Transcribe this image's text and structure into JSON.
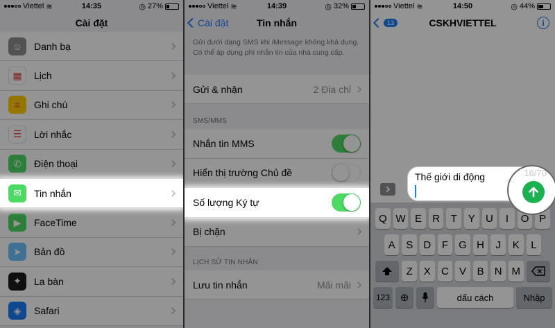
{
  "status": {
    "p1": {
      "carrier": "Viettel",
      "time": "14:35",
      "battery": "27%",
      "battery_level": 0.27
    },
    "p2": {
      "carrier": "Viettel",
      "time": "14:39",
      "battery": "32%",
      "battery_level": 0.32
    },
    "p3": {
      "carrier": "Viettel",
      "time": "14:50",
      "battery": "44%",
      "battery_level": 0.44
    }
  },
  "settings": {
    "title": "Cài đặt",
    "items": [
      {
        "label": "Danh bạ",
        "icon": "contacts-icon",
        "color": "#8e8e93"
      },
      {
        "label": "Lịch",
        "icon": "calendar-icon",
        "color": "#ffffff"
      },
      {
        "label": "Ghi chú",
        "icon": "notes-icon",
        "color": "#ffcc00"
      },
      {
        "label": "Lời nhắc",
        "icon": "reminders-icon",
        "color": "#ffffff"
      },
      {
        "label": "Điện thoại",
        "icon": "phone-icon",
        "color": "#4cd964"
      },
      {
        "label": "Tin nhắn",
        "icon": "messages-icon",
        "color": "#4cd964"
      },
      {
        "label": "FaceTime",
        "icon": "facetime-icon",
        "color": "#4cd964"
      },
      {
        "label": "Bản đồ",
        "icon": "maps-icon",
        "color": "#6ec1ff"
      },
      {
        "label": "La bàn",
        "icon": "compass-icon",
        "color": "#1c1c1e"
      },
      {
        "label": "Safari",
        "icon": "safari-icon",
        "color": "#1a7cf5"
      }
    ]
  },
  "messages": {
    "back": "Cài đặt",
    "title": "Tin nhắn",
    "note": "Gửi dưới dạng SMS khi iMessage không khả dụng. Có thể áp dụng phí nhắn tin của nhà cung cấp.",
    "send_receive": {
      "label": "Gửi & nhận",
      "value": "2 Địa chỉ"
    },
    "section_sms": "SMS/MMS",
    "mms": {
      "label": "Nhắn tin MMS",
      "on": true
    },
    "subject": {
      "label": "Hiển thị trường Chủ đề",
      "on": false
    },
    "char_count": {
      "label": "Số lượng Ký tự",
      "on": true
    },
    "blocked": {
      "label": "Bị chặn"
    },
    "section_history": "LỊCH SỬ TIN NHẮN",
    "keep": {
      "label": "Lưu tin nhắn",
      "value": "Mãi mãi"
    }
  },
  "conversation": {
    "badge": "13",
    "title": "CSKHVIETTEL",
    "info": "i",
    "draft": "Thế giới di động",
    "counter": "16/70"
  },
  "keyboard": {
    "row1": [
      "Q",
      "W",
      "E",
      "R",
      "T",
      "Y",
      "U",
      "I",
      "O",
      "P"
    ],
    "row2": [
      "A",
      "S",
      "D",
      "F",
      "G",
      "H",
      "J",
      "K",
      "L"
    ],
    "row3": [
      "Z",
      "X",
      "C",
      "V",
      "B",
      "N",
      "M"
    ],
    "numbers": "123",
    "space": "dấu cách",
    "enter": "Nhập"
  }
}
